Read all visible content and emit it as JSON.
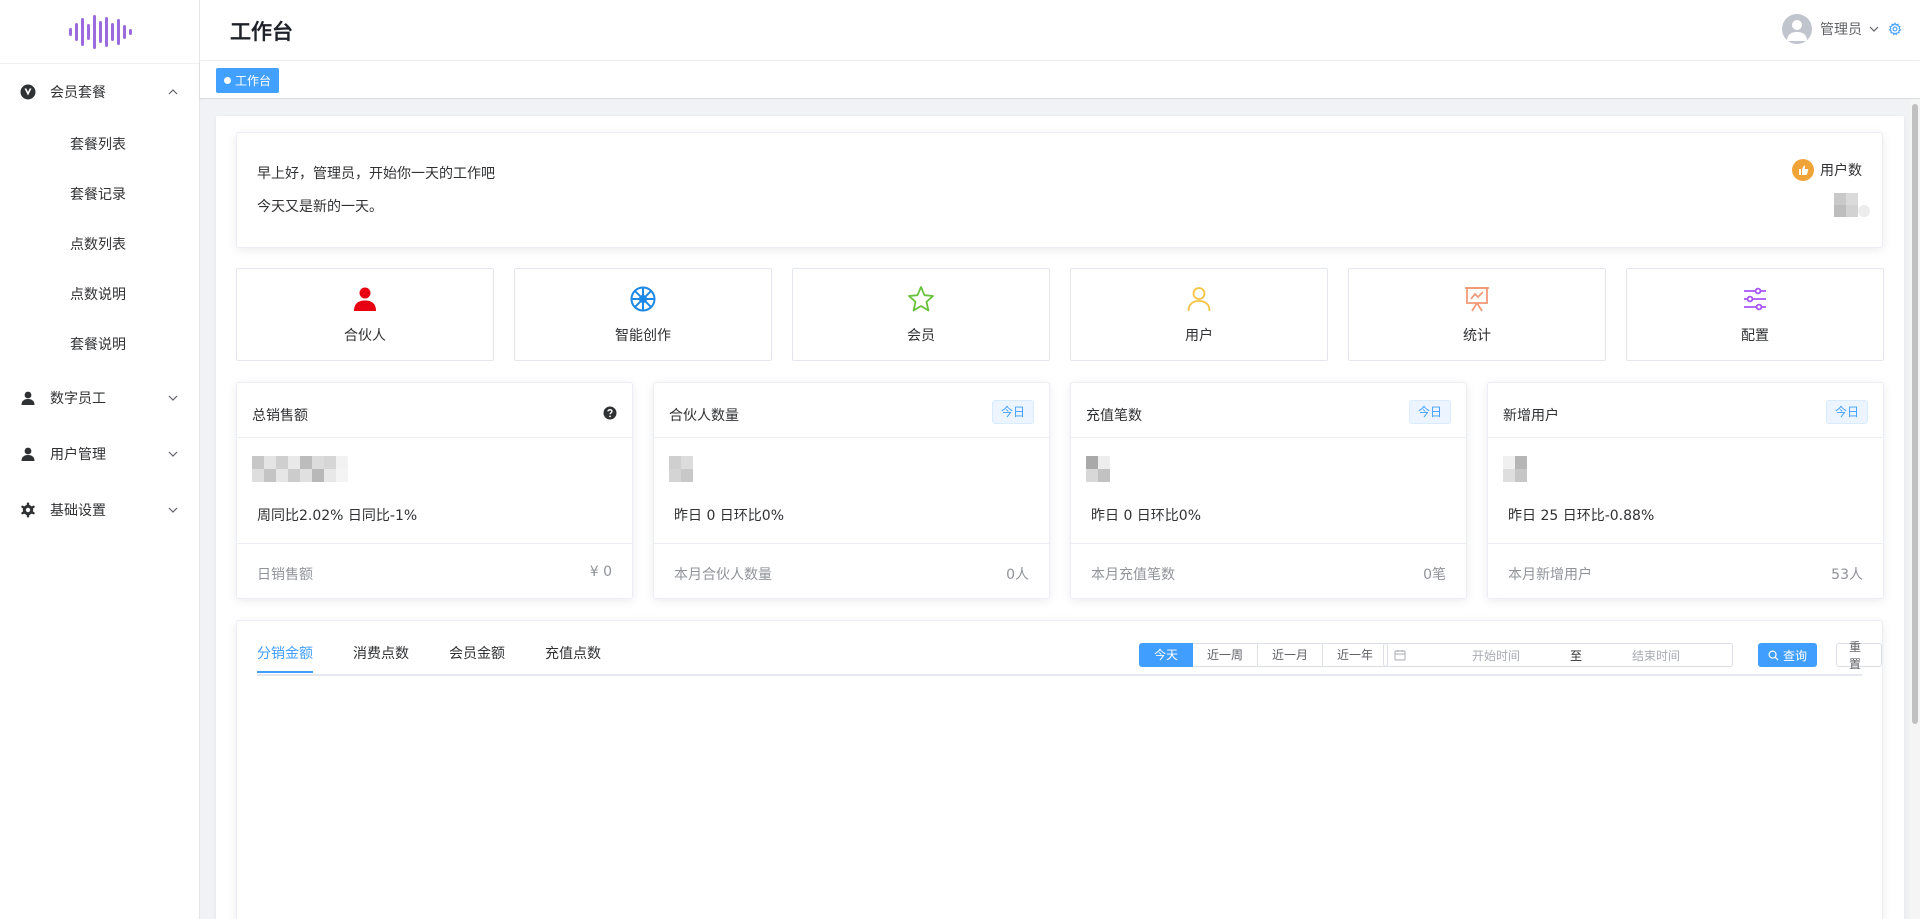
{
  "sidebar": {
    "groups": [
      {
        "label": "会员套餐",
        "icon": "v-logo-icon",
        "expanded": true,
        "items": [
          {
            "label": "套餐列表"
          },
          {
            "label": "套餐记录"
          },
          {
            "label": "点数列表"
          },
          {
            "label": "点数说明"
          },
          {
            "label": "套餐说明"
          }
        ]
      },
      {
        "label": "数字员工",
        "icon": "user-icon",
        "expanded": false
      },
      {
        "label": "用户管理",
        "icon": "user-icon",
        "expanded": false
      },
      {
        "label": "基础设置",
        "icon": "gear-icon",
        "expanded": false
      }
    ]
  },
  "header": {
    "title": "工作台",
    "user_name": "管理员"
  },
  "tags": [
    {
      "label": "工作台",
      "active": true
    }
  ],
  "greeting": {
    "line1": "早上好，管理员，开始你一天的工作吧",
    "line2": "今天又是新的一天。",
    "user_count_label": "用户数"
  },
  "quick_links": [
    {
      "label": "合伙人",
      "icon": "partner-icon",
      "color": "#e60012"
    },
    {
      "label": "智能创作",
      "icon": "wheel-icon",
      "color": "#1e88e5"
    },
    {
      "label": "会员",
      "icon": "star-icon",
      "color": "#67c23a"
    },
    {
      "label": "用户",
      "icon": "person-icon",
      "color": "#f5c342"
    },
    {
      "label": "统计",
      "icon": "presentation-chart-icon",
      "color": "#f29a76"
    },
    {
      "label": "配置",
      "icon": "sliders-icon",
      "color": "#a855f7"
    }
  ],
  "stats": [
    {
      "title": "总销售额",
      "badge": "",
      "compare": "周同比2.02%   日同比-1%",
      "footer_label": "日销售额",
      "footer_value": "¥ 0"
    },
    {
      "title": "合伙人数量",
      "badge": "今日",
      "compare": "昨日 0   日环比0%",
      "footer_label": "本月合伙人数量",
      "footer_value": "0人"
    },
    {
      "title": "充值笔数",
      "badge": "今日",
      "compare": "昨日 0   日环比0%",
      "footer_label": "本月充值笔数",
      "footer_value": "0笔"
    },
    {
      "title": "新增用户",
      "badge": "今日",
      "compare": "昨日 25   日环比-0.88%",
      "footer_label": "本月新增用户",
      "footer_value": "53人"
    }
  ],
  "chart_panel": {
    "tabs": [
      {
        "label": "分销金额"
      },
      {
        "label": "消费点数"
      },
      {
        "label": "会员金额"
      },
      {
        "label": "充值点数"
      }
    ],
    "ranges": [
      {
        "label": "今天"
      },
      {
        "label": "近一周"
      },
      {
        "label": "近一月"
      },
      {
        "label": "近一年"
      }
    ],
    "start_placeholder": "开始时间",
    "range_separator": "至",
    "end_placeholder": "结束时间",
    "search_label": "查询",
    "reset_label": "重置"
  },
  "colors": {
    "primary": "#409eff",
    "tag": "#42a0ff",
    "logo": "#9b6bde"
  }
}
